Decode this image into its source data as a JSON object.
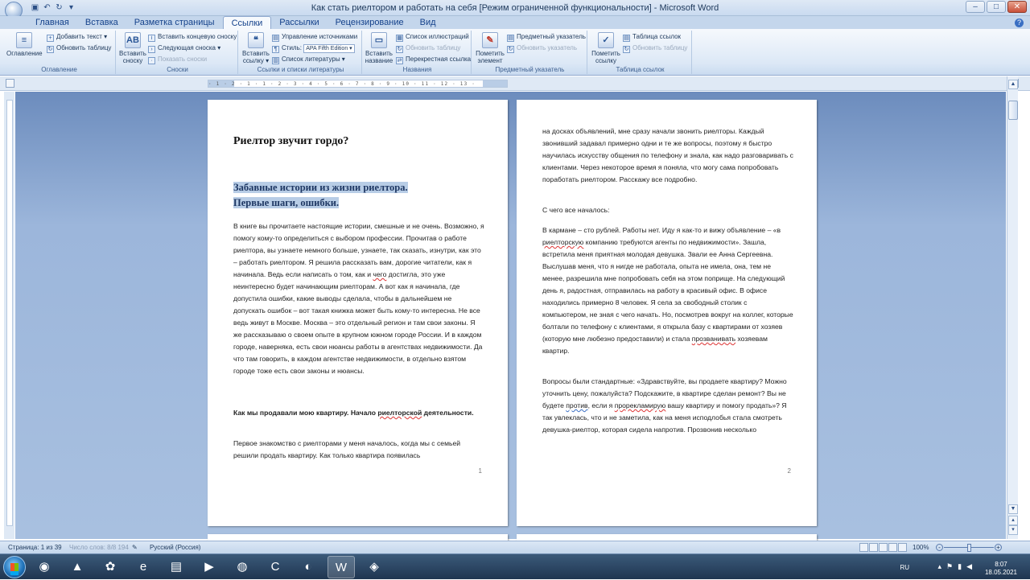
{
  "window": {
    "title": "Как стать риелтором и работать на себя [Режим ограниченной функциональности] - Microsoft Word",
    "controls": {
      "minimize": "–",
      "maximize": "□",
      "close": "✕"
    }
  },
  "qat": {
    "save_icon": "▣",
    "undo_icon": "↶",
    "redo_icon": "↻",
    "more_icon": "▾"
  },
  "tabs": [
    "Главная",
    "Вставка",
    "Разметка страницы",
    "Ссылки",
    "Рассылки",
    "Рецензирование",
    "Вид"
  ],
  "active_tab": "Ссылки",
  "ribbon": {
    "toc": {
      "label": "Оглавление",
      "big": "Оглавление",
      "add_text": "Добавить текст ▾",
      "update_table": "Обновить таблицу"
    },
    "footnotes": {
      "label": "Сноски",
      "insert": "Вставить сноску",
      "insert_endnote": "Вставить концевую сноску",
      "next": "Следующая сноска ▾",
      "show": "Показать сноски"
    },
    "citations": {
      "label": "Ссылки и списки литературы",
      "insert": "Вставить ссылку ▾",
      "manage": "Управление источниками",
      "style_label": "Стиль:",
      "style_value": "APA Fifth Edition ▾",
      "bibliography": "Список литературы ▾"
    },
    "captions": {
      "label": "Названия",
      "insert": "Вставить название",
      "figures": "Список иллюстраций",
      "update": "Обновить таблицу",
      "cross": "Перекрестная ссылка"
    },
    "index": {
      "label": "Предметный указатель",
      "mark": "Пометить элемент",
      "insert": "Предметный указатель",
      "update": "Обновить указатель"
    },
    "toa": {
      "label": "Таблица ссылок",
      "mark": "Пометить ссылку",
      "insert": "Таблица ссылок",
      "update": "Обновить таблицу"
    }
  },
  "ruler_ticks": "· 1 · 2 · 1 · 1 · 2 · 3 · 4 · 5 · 6 · 7 · 8 · 9 · 10 · 11 · 12 · 13 ·",
  "page1": {
    "heading": "Риелтор звучит гордо?",
    "subheading_line1": "Забавные истории из жизни риелтора.",
    "subheading_line2": "Первые шаги, ошибки.",
    "body_a": " В книге вы прочитаете настоящие истории, смешные и не очень. Возможно, я помогу кому-то  определиться с выбором профессии. Прочитав о работе риелтора,  вы узнаете немного больше, узнаете, так сказать, изнутри, как это – работать риелтором.  Я решила рассказать вам, дорогие читатели, как я начинала. Ведь если написать о том, как и ",
    "body_squig": "чего",
    "body_b": " достигла, это уже неинтересно будет начинающим риелторам. А вот как я начинала, где допустила ошибки, какие выводы сделала, чтобы в дальнейшем не допускать ошибок – вот такая книжка может быть кому-то интересна. Не все ведь живут в Москве. Москва – это отдельный регион и там свои законы. Я же рассказываю о своем опыте в крупном южном городе России. И в каждом городе, наверняка, есть свои нюансы работы в агентствах недвижимости. Да что там говорить, в каждом агентстве недвижимости, в отдельно взятом городе тоже есть свои законы и нюансы.",
    "bold_a": "Как мы продавали мою квартиру. Начало ",
    "bold_squig": "риелторской",
    "bold_b": " деятельности.",
    "end": "Первое знакомство с риелторами у меня началось, когда мы с семьей решили продать квартиру. Как только квартира появилась",
    "page_number": "1"
  },
  "page2": {
    "para_a": "на досках объявлений, мне сразу начали звонить риелторы. Каждый звонивший задавал примерно одни и те же вопросы, поэтому я быстро научилась искусству общения по телефону и знала, как надо разговаривать с клиентами. Через некоторое время я поняла, что могу сама попробовать поработать риелтором. Расскажу все подробно.",
    "para_b": "С чего все началось:",
    "para_c1": "В кармане – сто рублей. Работы нет. Иду я как-то и вижу объявление – «в ",
    "para_c_squig": "риелторскую",
    "para_c2": " компанию требуются агенты по недвижимости». Зашла, встретила меня приятная молодая девушка. Звали ее Анна Сергеевна.  Выслушав меня, что я нигде не работала, опыта не имела, она, тем не менее, разрешила мне попробовать себя на этом поприще.  На следующий день я, радостная, отправилась на работу в красивый офис. В офисе находились примерно 8 человек.  Я села за свободный столик с компьютером, не зная  с чего начать. Но, посмотрев вокруг  на коллег, которые болтали по телефону с клиентами, я открыла базу с квартирами от хозяев (которую  мне любезно предоставили) и стала ",
    "para_c_squig2": "прозванивать",
    "para_c3": " хозяевам квартир.",
    "para_d1": " Вопросы были стандартные:  «Здравствуйте, вы продаете квартиру? Можно уточнить цену, пожалуйста? Подскажите, в квартире сделан ремонт? Вы не будете ",
    "para_d_squig": "против",
    "para_d2": ", если я ",
    "para_d_squig2": "прорекламирую",
    "para_d3": " вашу квартиру и помогу продать»? Я так увлеклась, что и не заметила, как на меня исподлобья стала смотреть девушка-риелтор, которая сидела напротив.  Прозвонив несколько",
    "page_number": "2"
  },
  "statusbar": {
    "page": "Страница: 1 из 39",
    "words": "Число слов: 8/8 194",
    "language": "Русский (Россия)",
    "zoom": "100%",
    "zoom_fraction": 0.5
  },
  "taskbar": {
    "apps": [
      "◉",
      "▲",
      "✿",
      "e",
      "▤",
      "▶",
      "◍",
      "C",
      "◐",
      "W",
      "◈"
    ],
    "active_app_index": 9,
    "lang": "RU",
    "time": "8:07",
    "date": "18.05.2021"
  },
  "colors": {
    "accent": "#2b579a",
    "selection": "#b8cde6",
    "workspace": "#9cb6db"
  }
}
